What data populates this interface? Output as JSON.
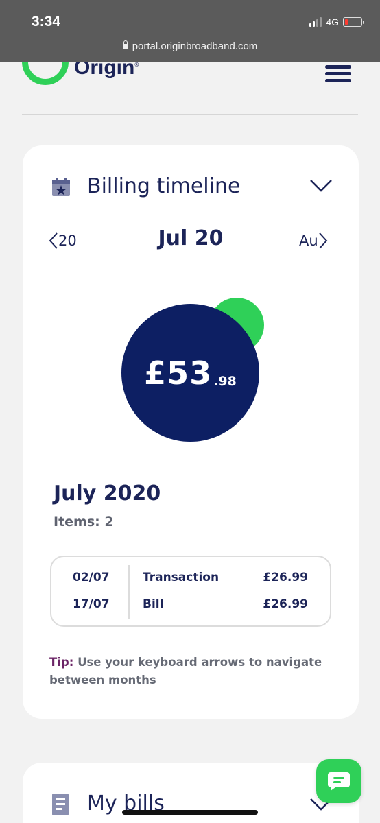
{
  "statusbar": {
    "time": "3:34",
    "network": "4G",
    "url": "portal.originbroadband.com"
  },
  "header": {
    "logo_text": "Origin",
    "logo_mark": "®",
    "brand_color": "#2fd058",
    "menu_icon": "hamburger-icon"
  },
  "billing": {
    "title": "Billing timeline",
    "title_icon": "calendar-star-icon",
    "toggle_icon": "chevron-down-icon",
    "prev_label": "20",
    "next_label": "Au",
    "current_month": "Jul 20",
    "amount_main": "£53",
    "amount_decimal": ".98",
    "period": "July 2020",
    "items_count": "Items: 2",
    "transactions": [
      {
        "date": "02/07",
        "description": "Transaction",
        "amount": "£26.99"
      },
      {
        "date": "17/07",
        "description": "Bill",
        "amount": "£26.99"
      }
    ],
    "tip_label": "Tip:",
    "tip_text": "Use your keyboard arrows to navigate between months"
  },
  "bills": {
    "title": "My bills",
    "title_icon": "document-icon",
    "toggle_icon": "chevron-down-icon"
  },
  "chat": {
    "icon": "chat-bubble-icon"
  },
  "colors": {
    "navy": "#1c2458",
    "bubble": "#0d1f63",
    "green": "#2fd058",
    "tip_label": "#6b2466"
  }
}
